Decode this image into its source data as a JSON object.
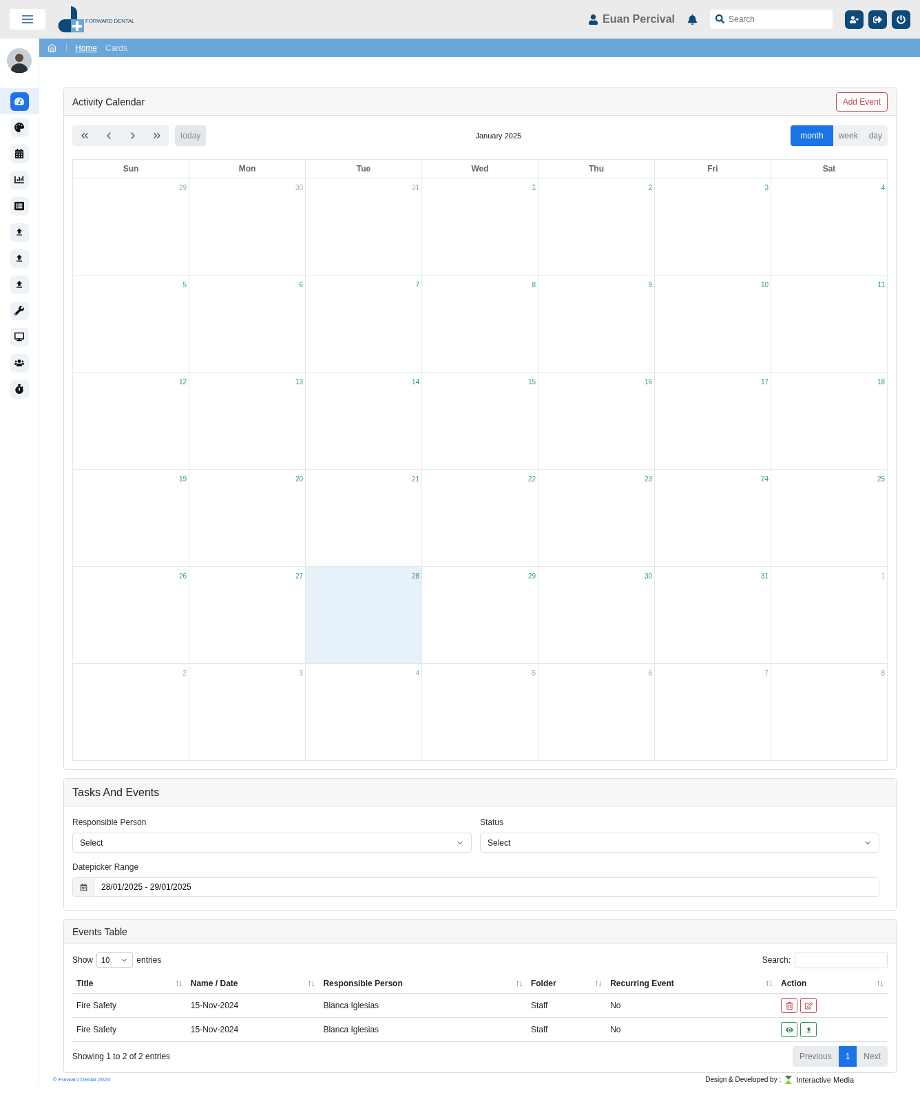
{
  "header": {
    "brand": "FORWARD DENTAL",
    "user": "Euan Percival",
    "search": {
      "placeholder": "Search"
    }
  },
  "breadcrumb": {
    "items": [
      {
        "label": "Home",
        "current": false
      },
      {
        "label": "Cards",
        "current": true
      }
    ]
  },
  "sidebar": {
    "items": [
      {
        "selected": true
      },
      {
        "selected": false
      },
      {
        "selected": false
      },
      {
        "selected": false
      },
      {
        "selected": false
      },
      {
        "selected": false
      },
      {
        "selected": false
      },
      {
        "selected": false
      },
      {
        "selected": false
      },
      {
        "selected": false
      },
      {
        "selected": false
      },
      {
        "selected": false
      }
    ]
  },
  "calendar": {
    "title": "Activity Calendar",
    "add_button": "Add Event",
    "today_button": {
      "label": "today",
      "disabled": true
    },
    "month_label": "January 2025",
    "views": [
      {
        "label": "month",
        "selected": true
      },
      {
        "label": "week",
        "selected": false
      },
      {
        "label": "day",
        "selected": false
      }
    ],
    "weekdays": [
      "Sun",
      "Mon",
      "Tue",
      "Wed",
      "Thu",
      "Fri",
      "Sat"
    ],
    "weeks": [
      [
        {
          "day": "29",
          "other_month": true,
          "today": false
        },
        {
          "day": "30",
          "other_month": true,
          "today": false
        },
        {
          "day": "31",
          "other_month": true,
          "today": false
        },
        {
          "day": "1",
          "other_month": false,
          "today": false
        },
        {
          "day": "2",
          "other_month": false,
          "today": false
        },
        {
          "day": "3",
          "other_month": false,
          "today": false
        },
        {
          "day": "4",
          "other_month": false,
          "today": false
        }
      ],
      [
        {
          "day": "5",
          "other_month": false,
          "today": false
        },
        {
          "day": "6",
          "other_month": false,
          "today": false
        },
        {
          "day": "7",
          "other_month": false,
          "today": false
        },
        {
          "day": "8",
          "other_month": false,
          "today": false
        },
        {
          "day": "9",
          "other_month": false,
          "today": false
        },
        {
          "day": "10",
          "other_month": false,
          "today": false
        },
        {
          "day": "11",
          "other_month": false,
          "today": false
        }
      ],
      [
        {
          "day": "12",
          "other_month": false,
          "today": false
        },
        {
          "day": "13",
          "other_month": false,
          "today": false
        },
        {
          "day": "14",
          "other_month": false,
          "today": false
        },
        {
          "day": "15",
          "other_month": false,
          "today": false
        },
        {
          "day": "16",
          "other_month": false,
          "today": false
        },
        {
          "day": "17",
          "other_month": false,
          "today": false
        },
        {
          "day": "18",
          "other_month": false,
          "today": false
        }
      ],
      [
        {
          "day": "19",
          "other_month": false,
          "today": false
        },
        {
          "day": "20",
          "other_month": false,
          "today": false
        },
        {
          "day": "21",
          "other_month": false,
          "today": false
        },
        {
          "day": "22",
          "other_month": false,
          "today": false
        },
        {
          "day": "23",
          "other_month": false,
          "today": false
        },
        {
          "day": "24",
          "other_month": false,
          "today": false
        },
        {
          "day": "25",
          "other_month": false,
          "today": false
        }
      ],
      [
        {
          "day": "26",
          "other_month": false,
          "today": false
        },
        {
          "day": "27",
          "other_month": false,
          "today": false
        },
        {
          "day": "28",
          "other_month": false,
          "today": true
        },
        {
          "day": "29",
          "other_month": false,
          "today": false
        },
        {
          "day": "30",
          "other_month": false,
          "today": false
        },
        {
          "day": "31",
          "other_month": false,
          "today": false
        },
        {
          "day": "1",
          "other_month": true,
          "today": false
        }
      ],
      [
        {
          "day": "2",
          "other_month": true,
          "today": false
        },
        {
          "day": "3",
          "other_month": true,
          "today": false
        },
        {
          "day": "4",
          "other_month": true,
          "today": false
        },
        {
          "day": "5",
          "other_month": true,
          "today": false
        },
        {
          "day": "6",
          "other_month": true,
          "today": false
        },
        {
          "day": "7",
          "other_month": true,
          "today": false
        },
        {
          "day": "8",
          "other_month": true,
          "today": false
        }
      ]
    ]
  },
  "tasks": {
    "title": "Tasks And Events",
    "responsible": {
      "label": "Responsible Person",
      "value": "Select"
    },
    "status": {
      "label": "Status",
      "value": "Select"
    },
    "range": {
      "label": "Datepicker Range",
      "value": "28/01/2025 - 29/01/2025"
    }
  },
  "events_table": {
    "title": "Events Table",
    "show_label": "Show",
    "page_size": "10",
    "entries_label": "entries",
    "search_label": "Search:",
    "columns": [
      "Title",
      "Name / Date",
      "Responsible Person",
      "Folder",
      "Recurring Event",
      "Action"
    ],
    "rows": [
      {
        "cells": [
          "Fire Safety",
          "15-Nov-2024",
          "Blanca Iglesias",
          "Staff",
          "No"
        ],
        "actions": [
          {
            "kind": "delete"
          },
          {
            "kind": "edit"
          }
        ]
      },
      {
        "cells": [
          "Fire Safety",
          "15-Nov-2024",
          "Blanca Iglesias",
          "Staff",
          "No"
        ],
        "actions": [
          {
            "kind": "view"
          },
          {
            "kind": "upload"
          }
        ]
      }
    ],
    "info": "Showing 1 to 2 of 2 entries",
    "pagination": [
      {
        "label": "Previous",
        "selected": false
      },
      {
        "label": "1",
        "selected": true
      },
      {
        "label": "Next",
        "selected": false
      }
    ]
  },
  "footer": {
    "copyright": "© Forward Dental 2024",
    "credit": "Design & Developed by :",
    "company": "Interactive Media"
  }
}
